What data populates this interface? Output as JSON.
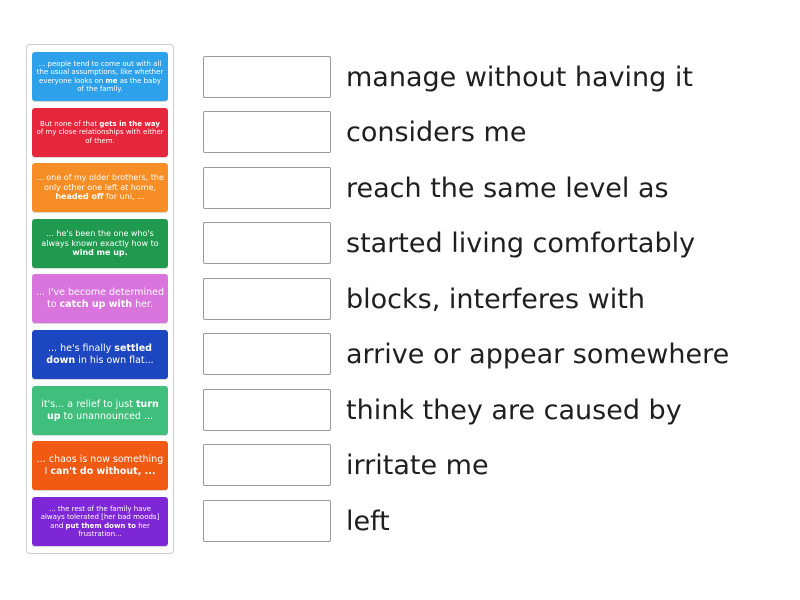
{
  "tiles": [
    {
      "color": "#2da1ea",
      "size": "t-sm",
      "parts": [
        {
          "t": "... people tend to come out with all the usual assumptions, like whether everyone looks on "
        },
        {
          "t": "me",
          "b": true
        },
        {
          "t": " as the baby of the family."
        }
      ]
    },
    {
      "color": "#e5263b",
      "size": "t-sm",
      "parts": [
        {
          "t": "But none of that "
        },
        {
          "t": "gets in the way",
          "b": true
        },
        {
          "t": " of my close relationships with either of them."
        }
      ]
    },
    {
      "color": "#f78d25",
      "size": "t-md",
      "parts": [
        {
          "t": "... one of my older brothers, the only other one left at home, "
        },
        {
          "t": "headed off",
          "b": true
        },
        {
          "t": " for uni, ..."
        }
      ]
    },
    {
      "color": "#1f9a4f",
      "size": "t-md",
      "parts": [
        {
          "t": "... he's been the one who's always known exactly how to "
        },
        {
          "t": "wind me up.",
          "b": true
        }
      ]
    },
    {
      "color": "#d874dc",
      "size": "t-lg",
      "parts": [
        {
          "t": "... I've become determined to "
        },
        {
          "t": "catch up with",
          "b": true
        },
        {
          "t": " her."
        }
      ]
    },
    {
      "color": "#1d47c1",
      "size": "t-lg",
      "parts": [
        {
          "t": "... he's finally "
        },
        {
          "t": "settled down",
          "b": true
        },
        {
          "t": " in his own flat..."
        }
      ]
    },
    {
      "color": "#3fbf7b",
      "size": "t-lg",
      "parts": [
        {
          "t": "it's... a relief to just "
        },
        {
          "t": "turn up",
          "b": true
        },
        {
          "t": " to unannounced ..."
        }
      ]
    },
    {
      "color": "#f15a13",
      "size": "t-lg",
      "parts": [
        {
          "t": "... chaos is now something I "
        },
        {
          "t": "can't do without, ...",
          "b": true
        }
      ]
    },
    {
      "color": "#7d27d6",
      "size": "t-sm",
      "parts": [
        {
          "t": "... the rest of the family have always tolerated [her bad moods] and "
        },
        {
          "t": "put them down to",
          "b": true
        },
        {
          "t": " her frustration..."
        }
      ]
    }
  ],
  "definitions": [
    "manage without having it",
    "considers me",
    "reach the same level as",
    "started living comfortably",
    "blocks, interferes with",
    "arrive or appear somewhere",
    "think they are caused by",
    "irritate me",
    "left"
  ]
}
